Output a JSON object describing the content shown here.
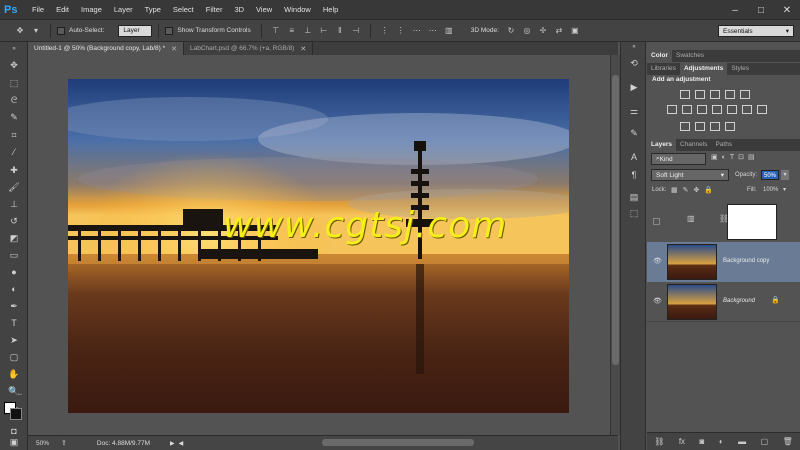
{
  "app": {
    "logo": "Ps",
    "menu": [
      "File",
      "Edit",
      "Image",
      "Layer",
      "Type",
      "Select",
      "Filter",
      "3D",
      "View",
      "Window",
      "Help"
    ],
    "window_controls": [
      "–",
      "□",
      "✕"
    ]
  },
  "options_bar": {
    "auto_select_label": "Auto-Select:",
    "auto_select_value": "Layer",
    "transform_label": "Show Transform Controls",
    "mode_3d_label": "3D Mode:",
    "workspace": "Essentials"
  },
  "tabs": [
    {
      "label": "Untitled-1 @ 50% (Background copy, Lab/8) *",
      "active": true
    },
    {
      "label": "LabChart.psd @ 66.7% (+a, RGB/8)",
      "active": false
    }
  ],
  "canvas": {
    "watermark": "www.cgtsj.com"
  },
  "status": {
    "zoom": "50%",
    "doc": "Doc: 4.88M/9.77M"
  },
  "panels": {
    "top_tabs": [
      "Color",
      "Swatches"
    ],
    "adj_tabs": [
      "Libraries",
      "Adjustments",
      "Styles"
    ],
    "add_adjustment": "Add an adjustment",
    "layer_tabs": [
      "Layers",
      "Channels",
      "Paths"
    ],
    "kind_filter": "Kind",
    "blend_mode": "Soft Light",
    "opacity_label": "Opacity:",
    "opacity_value": "50%",
    "lock_label": "Lock:",
    "fill_label": "Fill:",
    "fill_value": "100%",
    "layers": [
      {
        "name": "",
        "type": "adjustment"
      },
      {
        "name": "Background copy",
        "selected": true
      },
      {
        "name": "Background",
        "italic": true,
        "locked": true
      }
    ]
  }
}
